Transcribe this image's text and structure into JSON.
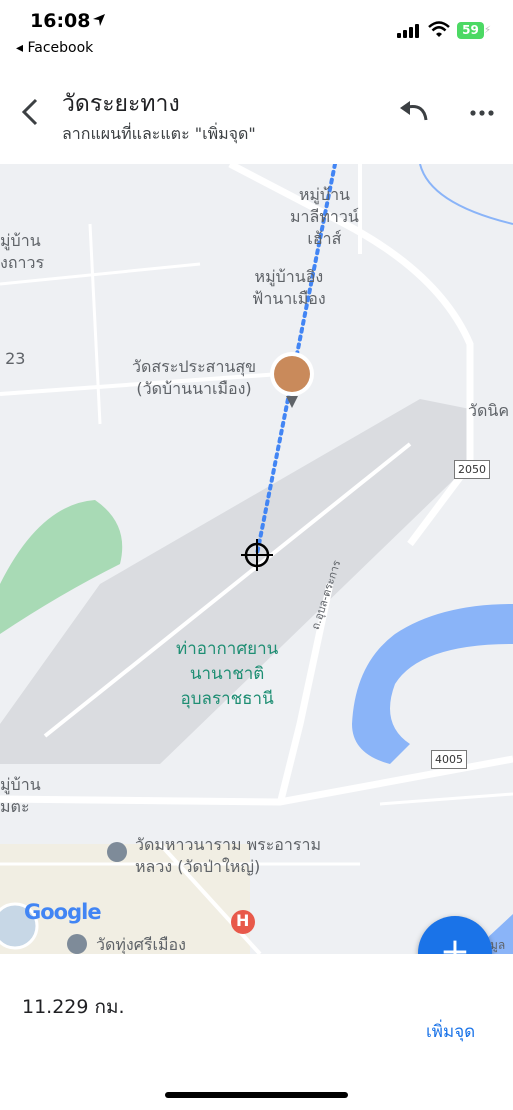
{
  "status_bar": {
    "time": "16:08",
    "back_app": "◂ Facebook",
    "battery": "59"
  },
  "header": {
    "title": "วัดระยะทาง",
    "subtitle": "ลากแผนที่และแตะ \"เพิ่มจุด\""
  },
  "map": {
    "labels": {
      "village1": "หมู่บ้าน\nมาลีทาวน์\nเฮ้าส์",
      "village2": "หมู่บ้านอิง\nฟ้านาเมือง",
      "village_left": "มู่บ้าน\nงถาวร",
      "left23": "ู่ 23",
      "temple": "วัดสระประสานสุข\n(วัดบ้านนาเมือง)",
      "right_edge": "วัดนิค",
      "airport": "ท่าอากาศยาน\nนานาชาติ\nอุบลราชธานี",
      "road_vert": "ถ.อุบล-ตระการ",
      "left_bottom": "มู่บ้าน\nมตะ",
      "wat_maha": "วัดมหาวนาราม พระอาราม\nหลวง (วัดป่าใหญ่)",
      "wat_bottom": "วัดทุ่งศรีเมือง",
      "right_bottom": "มูล"
    },
    "road_badges": [
      "2050",
      "4005"
    ],
    "google": "Google",
    "hospital": "H"
  },
  "fab": {
    "icon": "+"
  },
  "bottom": {
    "distance": "11.229 กม.",
    "add_point": "เพิ่มจุด"
  },
  "colors": {
    "accent": "#1a73e8",
    "map_bg": "#eef0f3",
    "water": "#8ab4f8",
    "park": "#a8dab5",
    "route": "#4285f4"
  }
}
